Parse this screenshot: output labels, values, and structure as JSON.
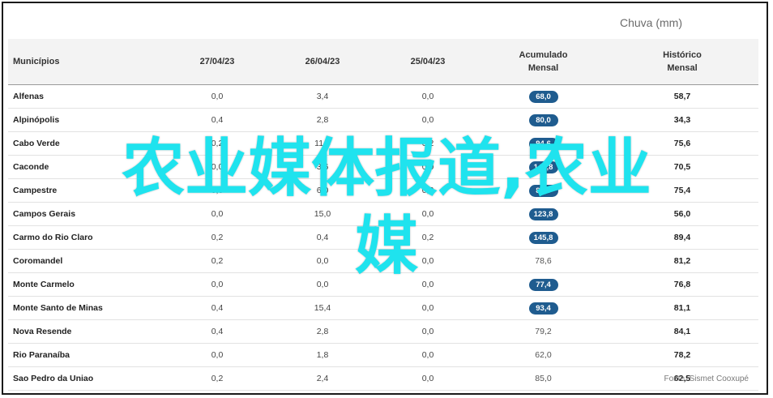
{
  "chart_data": {
    "type": "table",
    "title": "Chuva (mm)",
    "source": "Fonte: Sismet Cooxupé",
    "columns": [
      "Municípios",
      "27/04/23",
      "26/04/23",
      "25/04/23",
      "Acumulado Mensal",
      "Histórico Mensal"
    ],
    "rows": [
      [
        "Alfenas",
        "0,0",
        "3,4",
        "0,0",
        "68,0",
        "58,7"
      ],
      [
        "Alpinópolis",
        "0,4",
        "2,8",
        "0,0",
        "80,0",
        "34,3"
      ],
      [
        "Cabo Verde",
        "0,2",
        "11,4",
        "0,2",
        "94,6",
        "75,6"
      ],
      [
        "Caconde",
        "0,0",
        "3,6",
        "0,0",
        "140,8",
        "70,5"
      ],
      [
        "Campestre",
        "0,0",
        "6,0",
        "0,2",
        "89,0",
        "75,4"
      ],
      [
        "Campos Gerais",
        "0,0",
        "15,0",
        "0,0",
        "123,8",
        "56,0"
      ],
      [
        "Carmo do Rio Claro",
        "0,2",
        "0,4",
        "0,2",
        "145,8",
        "89,4"
      ],
      [
        "Coromandel",
        "0,2",
        "0,0",
        "0,0",
        "78,6",
        "81,2"
      ],
      [
        "Monte Carmelo",
        "0,0",
        "0,0",
        "0,0",
        "77,4",
        "76,8"
      ],
      [
        "Monte Santo de Minas",
        "0,4",
        "15,4",
        "0,0",
        "93,4",
        "81,1"
      ],
      [
        "Nova Resende",
        "0,4",
        "2,8",
        "0,0",
        "79,2",
        "84,1"
      ],
      [
        "Rio Paranaíba",
        "0,0",
        "1,8",
        "0,0",
        "62,0",
        "78,2"
      ],
      [
        "Sao Pedro da Uniao",
        "0,2",
        "2,4",
        "0,0",
        "85,0",
        "62,5"
      ]
    ],
    "highlight_rows": [
      true,
      true,
      true,
      true,
      true,
      true,
      true,
      false,
      true,
      true,
      false,
      false,
      false
    ],
    "highlight_color": "#1f5c8f"
  },
  "overlay": {
    "line1": "农业媒体报道,农业",
    "line2": "媒",
    "color": "#1fe3ee"
  }
}
